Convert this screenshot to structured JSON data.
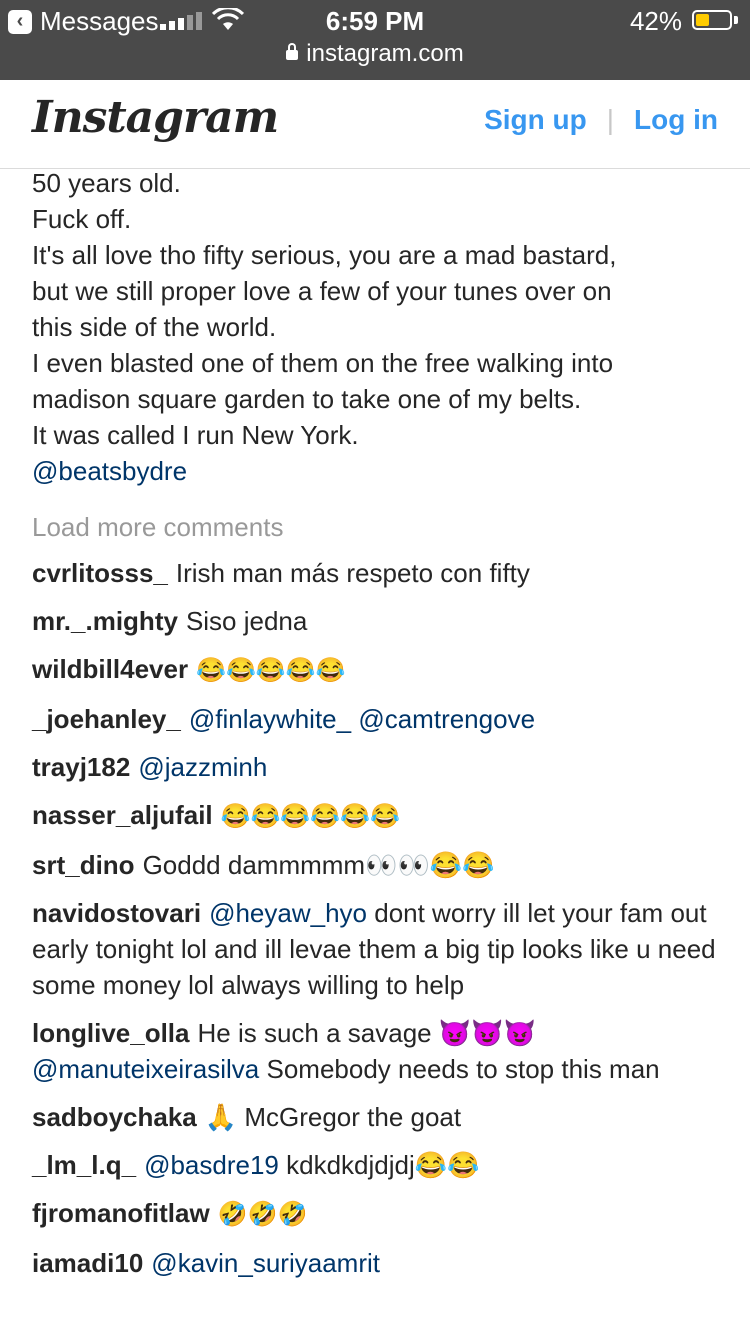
{
  "status_bar": {
    "back_label": "Messages",
    "time": "6:59 PM",
    "battery": "42%",
    "battery_level": 0.42,
    "url": "instagram.com"
  },
  "header": {
    "logo": "Instagram",
    "signup": "Sign up",
    "login": "Log in"
  },
  "caption_lines": [
    "50 years old.",
    "Fuck off.",
    "It's all love tho fifty serious, you are a mad bastard,",
    "but we still proper love a few of your tunes over on",
    "this side of the world.",
    "I even blasted one of them on the free walking into",
    "madison square garden to take one of my belts.",
    "It was called I run New York."
  ],
  "caption_mention": "@beatsbydre",
  "load_more": "Load more comments",
  "comments": [
    {
      "user": "cvrlitosss_",
      "mention": "",
      "text": "Irish man más respeto con fifty"
    },
    {
      "user": "mr._.mighty",
      "mention": "",
      "text": "Siso jedna"
    },
    {
      "user": "wildbill4ever",
      "mention": "",
      "text": "😂😂😂😂😂"
    },
    {
      "user": "_joehanley_",
      "mention": "@finlaywhite_ @camtrengove",
      "text": ""
    },
    {
      "user": "trayj182",
      "mention": "@jazzminh",
      "text": ""
    },
    {
      "user": "nasser_aljufail",
      "mention": "",
      "text": "😂😂😂😂😂😂"
    },
    {
      "user": "srt_dino",
      "mention": "",
      "text": "Goddd dammmmm👀👀😂😂"
    },
    {
      "user": "navidostovari",
      "mention": "@heyaw_hyo",
      "text": "dont worry ill let your fam out early tonight lol and ill levae them a big tip looks like u need some money lol always willing to help"
    },
    {
      "user": "longlive_olla",
      "mention": "",
      "text": "He is such a savage 😈😈😈"
    },
    {
      "user": "",
      "mention": "@manuteixeirasilva",
      "text": "Somebody needs to stop this man"
    },
    {
      "user": "sadboychaka",
      "mention": "",
      "text": "🙏 McGregor the goat"
    },
    {
      "user": "_lm_l.q_",
      "mention": "@basdre19",
      "text": "kdkdkdjdjdj😂😂"
    },
    {
      "user": "fjromanofitlaw",
      "mention": "",
      "text": "🤣🤣🤣"
    },
    {
      "user": "iamadi10",
      "mention": "@kavin_suriyaamrit",
      "text": ""
    }
  ]
}
